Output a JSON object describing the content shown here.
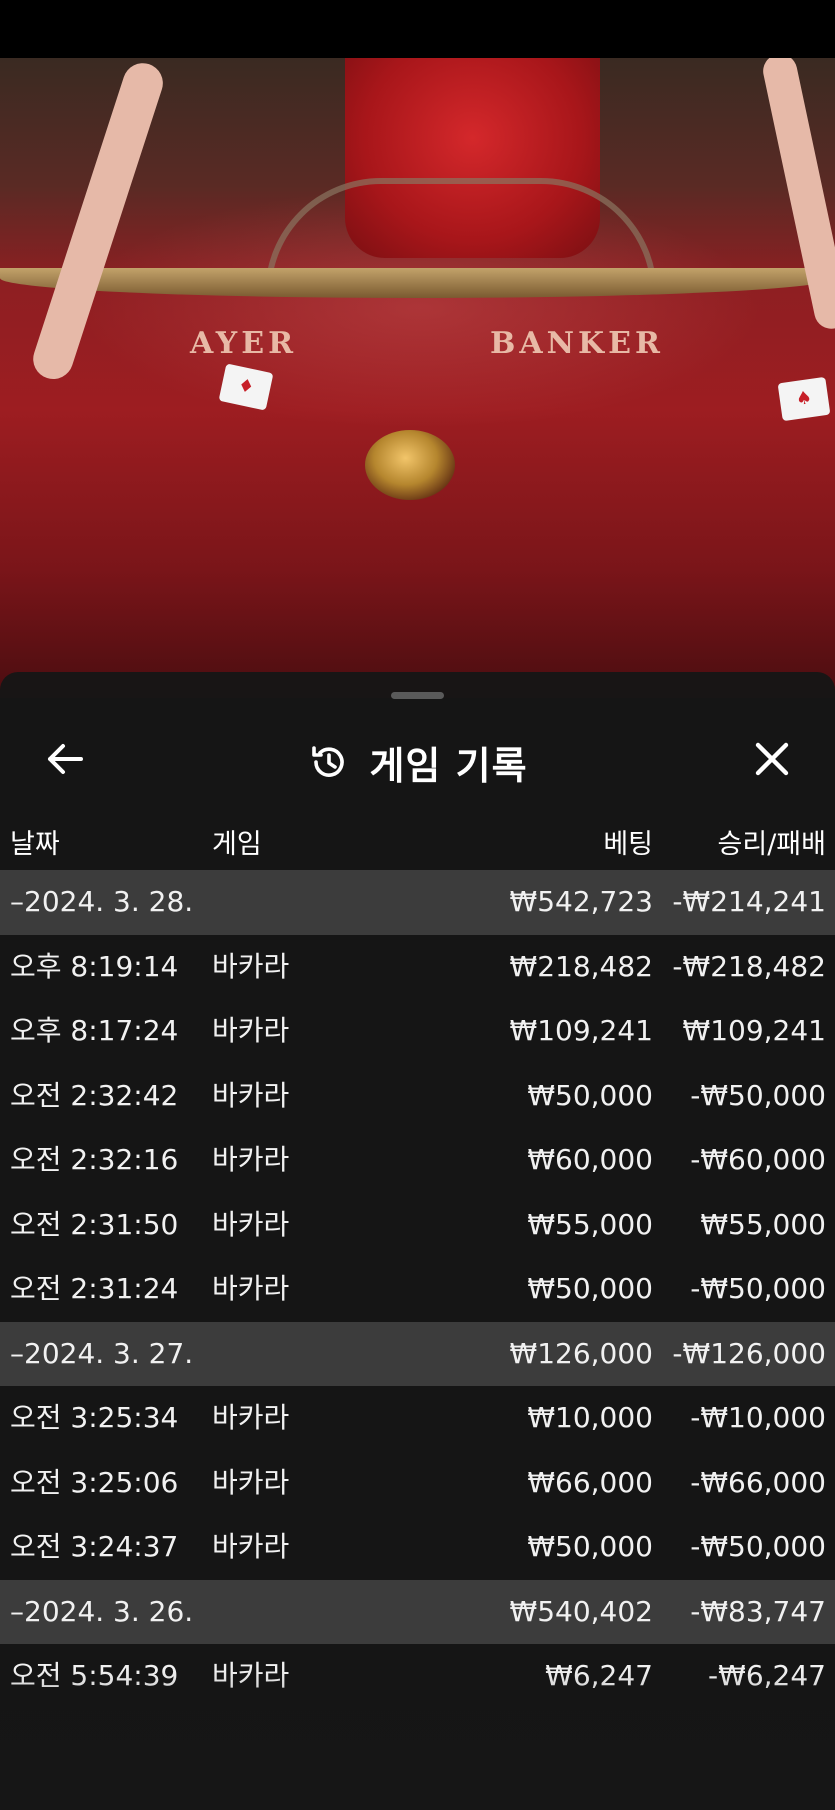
{
  "video": {
    "player_label": "AYER",
    "banker_label": "BANKER"
  },
  "sheet": {
    "title": "게임 기록",
    "back_icon": "arrow-left-icon",
    "history_icon": "history-icon",
    "close_icon": "close-icon",
    "columns": {
      "date": "날짜",
      "game": "게임",
      "bet": "베팅",
      "result": "승리/패배"
    },
    "rows": [
      {
        "type": "date",
        "date": "–2024. 3. 28.",
        "game": "",
        "bet": "₩542,723",
        "result": "-₩214,241"
      },
      {
        "type": "item",
        "date": "오후 8:19:14",
        "game": "바카라",
        "bet": "₩218,482",
        "result": "-₩218,482"
      },
      {
        "type": "item",
        "date": "오후 8:17:24",
        "game": "바카라",
        "bet": "₩109,241",
        "result": "₩109,241"
      },
      {
        "type": "item",
        "date": "오전 2:32:42",
        "game": "바카라",
        "bet": "₩50,000",
        "result": "-₩50,000"
      },
      {
        "type": "item",
        "date": "오전 2:32:16",
        "game": "바카라",
        "bet": "₩60,000",
        "result": "-₩60,000"
      },
      {
        "type": "item",
        "date": "오전 2:31:50",
        "game": "바카라",
        "bet": "₩55,000",
        "result": "₩55,000"
      },
      {
        "type": "item",
        "date": "오전 2:31:24",
        "game": "바카라",
        "bet": "₩50,000",
        "result": "-₩50,000"
      },
      {
        "type": "date",
        "date": "–2024. 3. 27.",
        "game": "",
        "bet": "₩126,000",
        "result": "-₩126,000"
      },
      {
        "type": "item",
        "date": "오전 3:25:34",
        "game": "바카라",
        "bet": "₩10,000",
        "result": "-₩10,000"
      },
      {
        "type": "item",
        "date": "오전 3:25:06",
        "game": "바카라",
        "bet": "₩66,000",
        "result": "-₩66,000"
      },
      {
        "type": "item",
        "date": "오전 3:24:37",
        "game": "바카라",
        "bet": "₩50,000",
        "result": "-₩50,000"
      },
      {
        "type": "date",
        "date": "–2024. 3. 26.",
        "game": "",
        "bet": "₩540,402",
        "result": "-₩83,747"
      },
      {
        "type": "item",
        "date": "오전 5:54:39",
        "game": "바카라",
        "bet": "₩6,247",
        "result": "-₩6,247"
      }
    ]
  }
}
